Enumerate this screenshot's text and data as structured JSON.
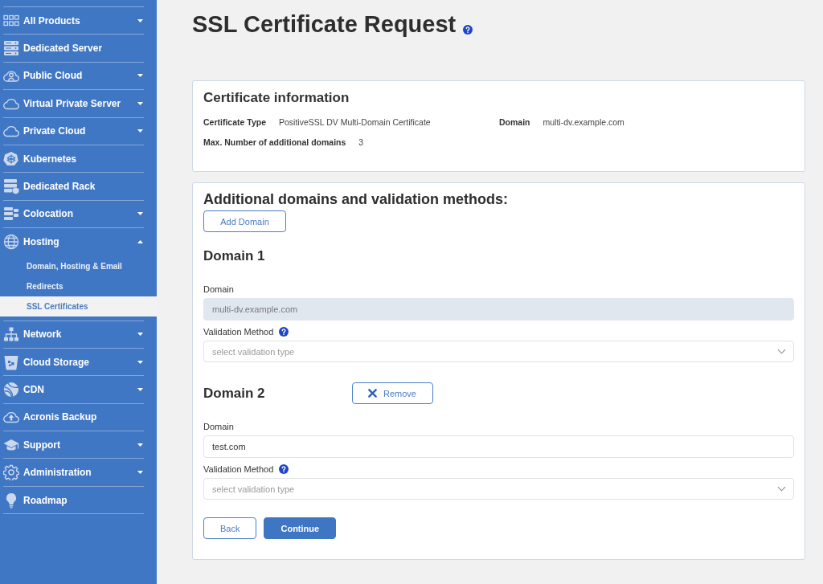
{
  "sidebar": {
    "items": [
      {
        "label": "All Products",
        "kind": "group",
        "expanded": false
      },
      {
        "label": "Dedicated Server",
        "kind": "link"
      },
      {
        "label": "Public Cloud",
        "kind": "group",
        "expanded": false
      },
      {
        "label": "Virtual Private Server",
        "kind": "group",
        "expanded": false
      },
      {
        "label": "Private Cloud",
        "kind": "group",
        "expanded": false
      },
      {
        "label": "Kubernetes",
        "kind": "link"
      },
      {
        "label": "Dedicated Rack",
        "kind": "link"
      },
      {
        "label": "Colocation",
        "kind": "group",
        "expanded": false
      },
      {
        "label": "Hosting",
        "kind": "group",
        "expanded": true,
        "children": [
          {
            "label": "Domain, Hosting & Email",
            "selected": false
          },
          {
            "label": "Redirects",
            "selected": false
          },
          {
            "label": "SSL Certificates",
            "selected": true
          }
        ]
      },
      {
        "label": "Network",
        "kind": "group",
        "expanded": false
      },
      {
        "label": "Cloud Storage",
        "kind": "group",
        "expanded": false
      },
      {
        "label": "CDN",
        "kind": "group",
        "expanded": false
      },
      {
        "label": "Acronis Backup",
        "kind": "link"
      },
      {
        "label": "Support",
        "kind": "group",
        "expanded": false
      },
      {
        "label": "Administration",
        "kind": "group",
        "expanded": false
      },
      {
        "label": "Roadmap",
        "kind": "link"
      }
    ]
  },
  "page": {
    "title": "SSL Certificate Request"
  },
  "certificate_info": {
    "heading": "Certificate information",
    "fields": [
      {
        "label": "Certificate Type",
        "value": "PositiveSSL DV Multi-Domain Certificate"
      },
      {
        "label": "Domain",
        "value": "multi-dv.example.com"
      },
      {
        "label": "Max. Number of additional domains",
        "value": "3"
      }
    ]
  },
  "domains_section": {
    "heading": "Additional domains and validation methods:",
    "add_button": "Add Domain",
    "domains": [
      {
        "title": "Domain 1",
        "domain_label": "Domain",
        "domain_value": "multi-dv.example.com",
        "disabled": true,
        "validation_label": "Validation Method",
        "validation_placeholder": "select validation type"
      },
      {
        "title": "Domain 2",
        "remove_button": "Remove",
        "domain_label": "Domain",
        "domain_value": "test.com",
        "disabled": false,
        "validation_label": "Validation Method",
        "validation_placeholder": "select validation type"
      }
    ],
    "buttons": [
      {
        "label": "Back",
        "kind": "secondary"
      },
      {
        "label": "Continue",
        "kind": "primary"
      }
    ]
  }
}
